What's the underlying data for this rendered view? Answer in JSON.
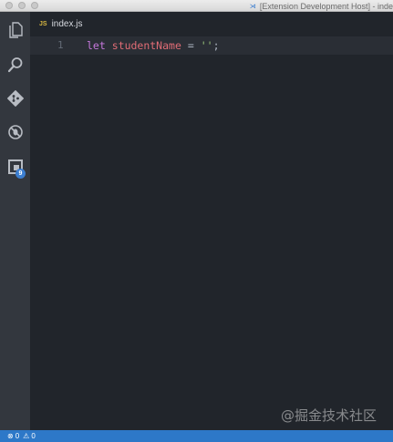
{
  "window": {
    "title": "[Extension Development Host] - inde",
    "title_icon": "vscode-icon"
  },
  "activity_bar": {
    "items": [
      {
        "name": "files-icon"
      },
      {
        "name": "search-icon"
      },
      {
        "name": "source-control-icon"
      },
      {
        "name": "debug-icon"
      },
      {
        "name": "extensions-icon",
        "badge": "9"
      }
    ]
  },
  "tabs": [
    {
      "icon": "JS",
      "label": "index.js"
    }
  ],
  "editor": {
    "lines": [
      {
        "number": "1",
        "tokens": {
          "keyword": "let",
          "identifier": "studentName",
          "operator": "=",
          "string": "''",
          "punct": ";"
        }
      }
    ]
  },
  "watermark": "@掘金技术社区",
  "status_bar": {
    "errors": "0",
    "warnings": "0",
    "error_glyph": "⊗",
    "warning_glyph": "⚠"
  },
  "colors": {
    "background": "#21252b",
    "activity_bar": "#33373e",
    "status_bar": "#2d78c8",
    "keyword": "#c678dd",
    "variable": "#e06c75",
    "string": "#98c379",
    "badge": "#3c7ed0"
  }
}
